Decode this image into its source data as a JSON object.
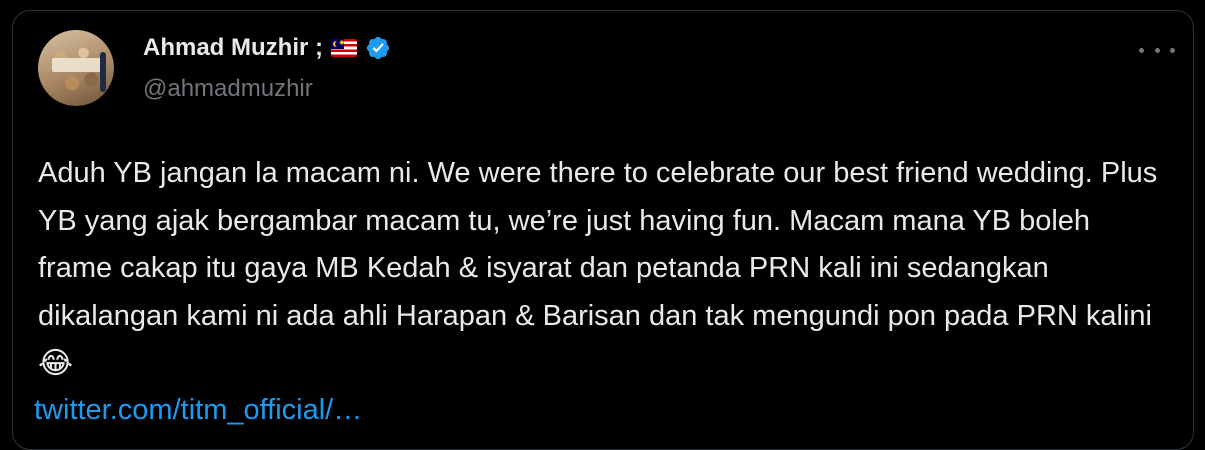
{
  "author": {
    "display_name": "Ahmad Muzhir ;",
    "handle": "@ahmadmuzhir",
    "flag_icon": "malaysia-flag-icon",
    "verified_icon": "verified-badge-icon"
  },
  "tweet": {
    "text": "Aduh YB jangan la macam ni. We were there to celebrate our best friend wedding. Plus YB yang ajak bergambar macam tu, we’re just having fun. Macam mana YB boleh frame cakap itu gaya MB Kedah & isyarat dan petanda PRN kali ini sedangkan dikalangan kami ni ada ahli Harapan & Barisan dan tak mengundi pon pada PRN kalini",
    "emoji": "😂",
    "link": "twitter.com/titm_official/…"
  },
  "colors": {
    "background": "#000000",
    "text": "#e7e9ea",
    "muted": "#71767b",
    "accent": "#1d9bf0"
  }
}
